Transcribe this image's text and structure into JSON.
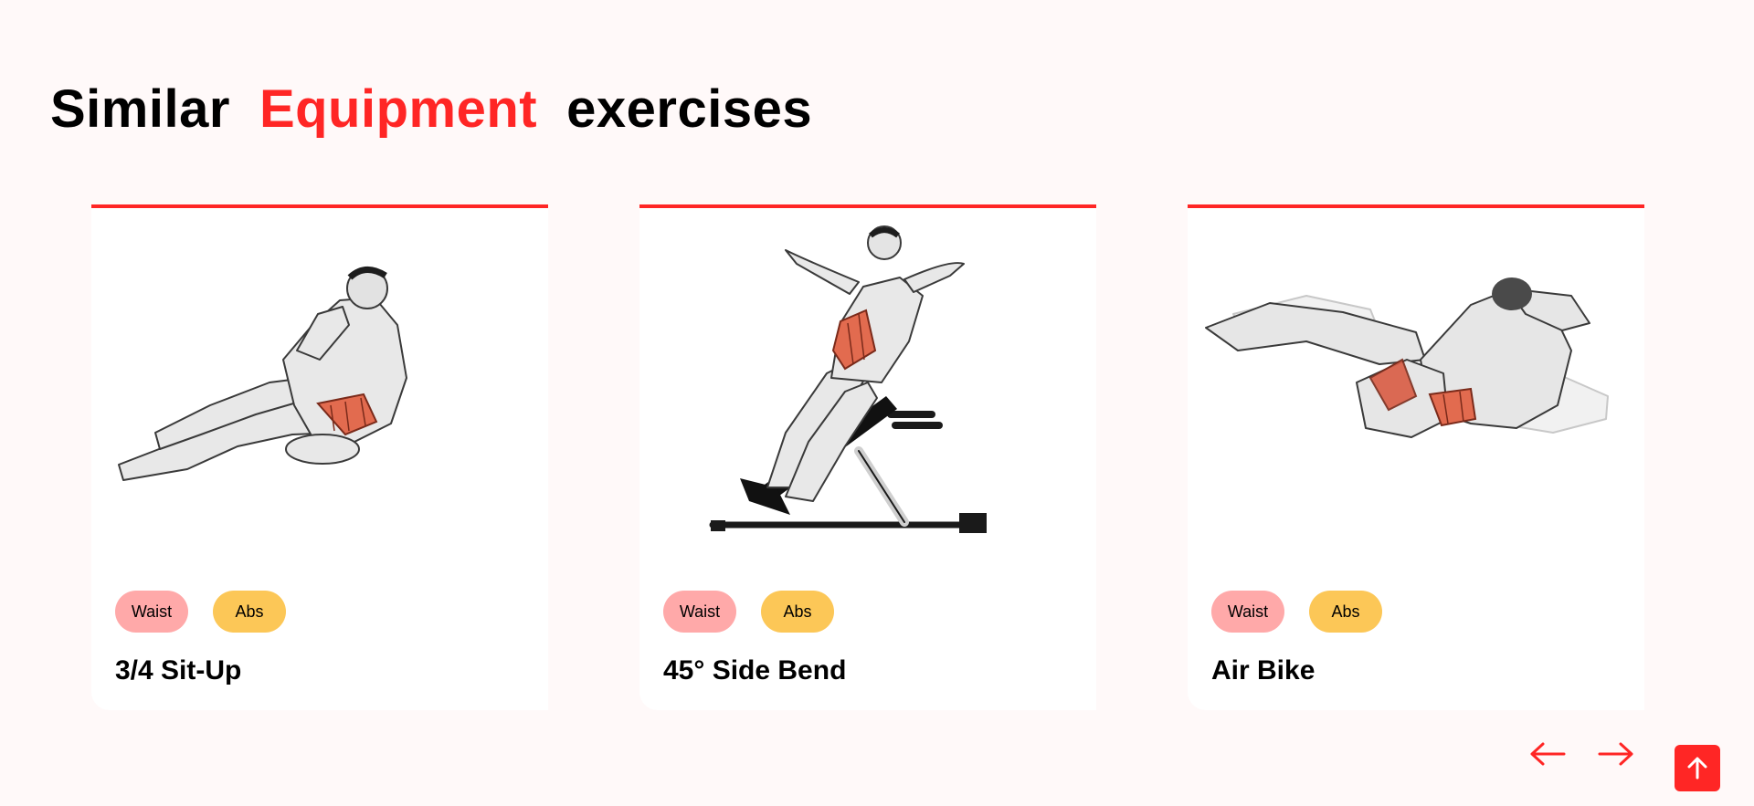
{
  "section": {
    "title_part1": "Similar",
    "title_accent": "Equipment",
    "title_part2": "exercises",
    "accent_color": "#ff2625"
  },
  "exercises": [
    {
      "name": "3/4 Sit-Up",
      "body_part": "Waist",
      "target": "Abs",
      "image_icon": "sit-up-illustration"
    },
    {
      "name": "45° Side Bend",
      "body_part": "Waist",
      "target": "Abs",
      "image_icon": "side-bend-bench-illustration"
    },
    {
      "name": "Air Bike",
      "body_part": "Waist",
      "target": "Abs",
      "image_icon": "air-bike-illustration"
    }
  ],
  "tag_colors": {
    "body_part": "#ffa9a9",
    "target": "#fcc757"
  },
  "navigation": {
    "prev_icon": "arrow-left-icon",
    "next_icon": "arrow-right-icon",
    "scroll_top_icon": "arrow-up-icon"
  }
}
